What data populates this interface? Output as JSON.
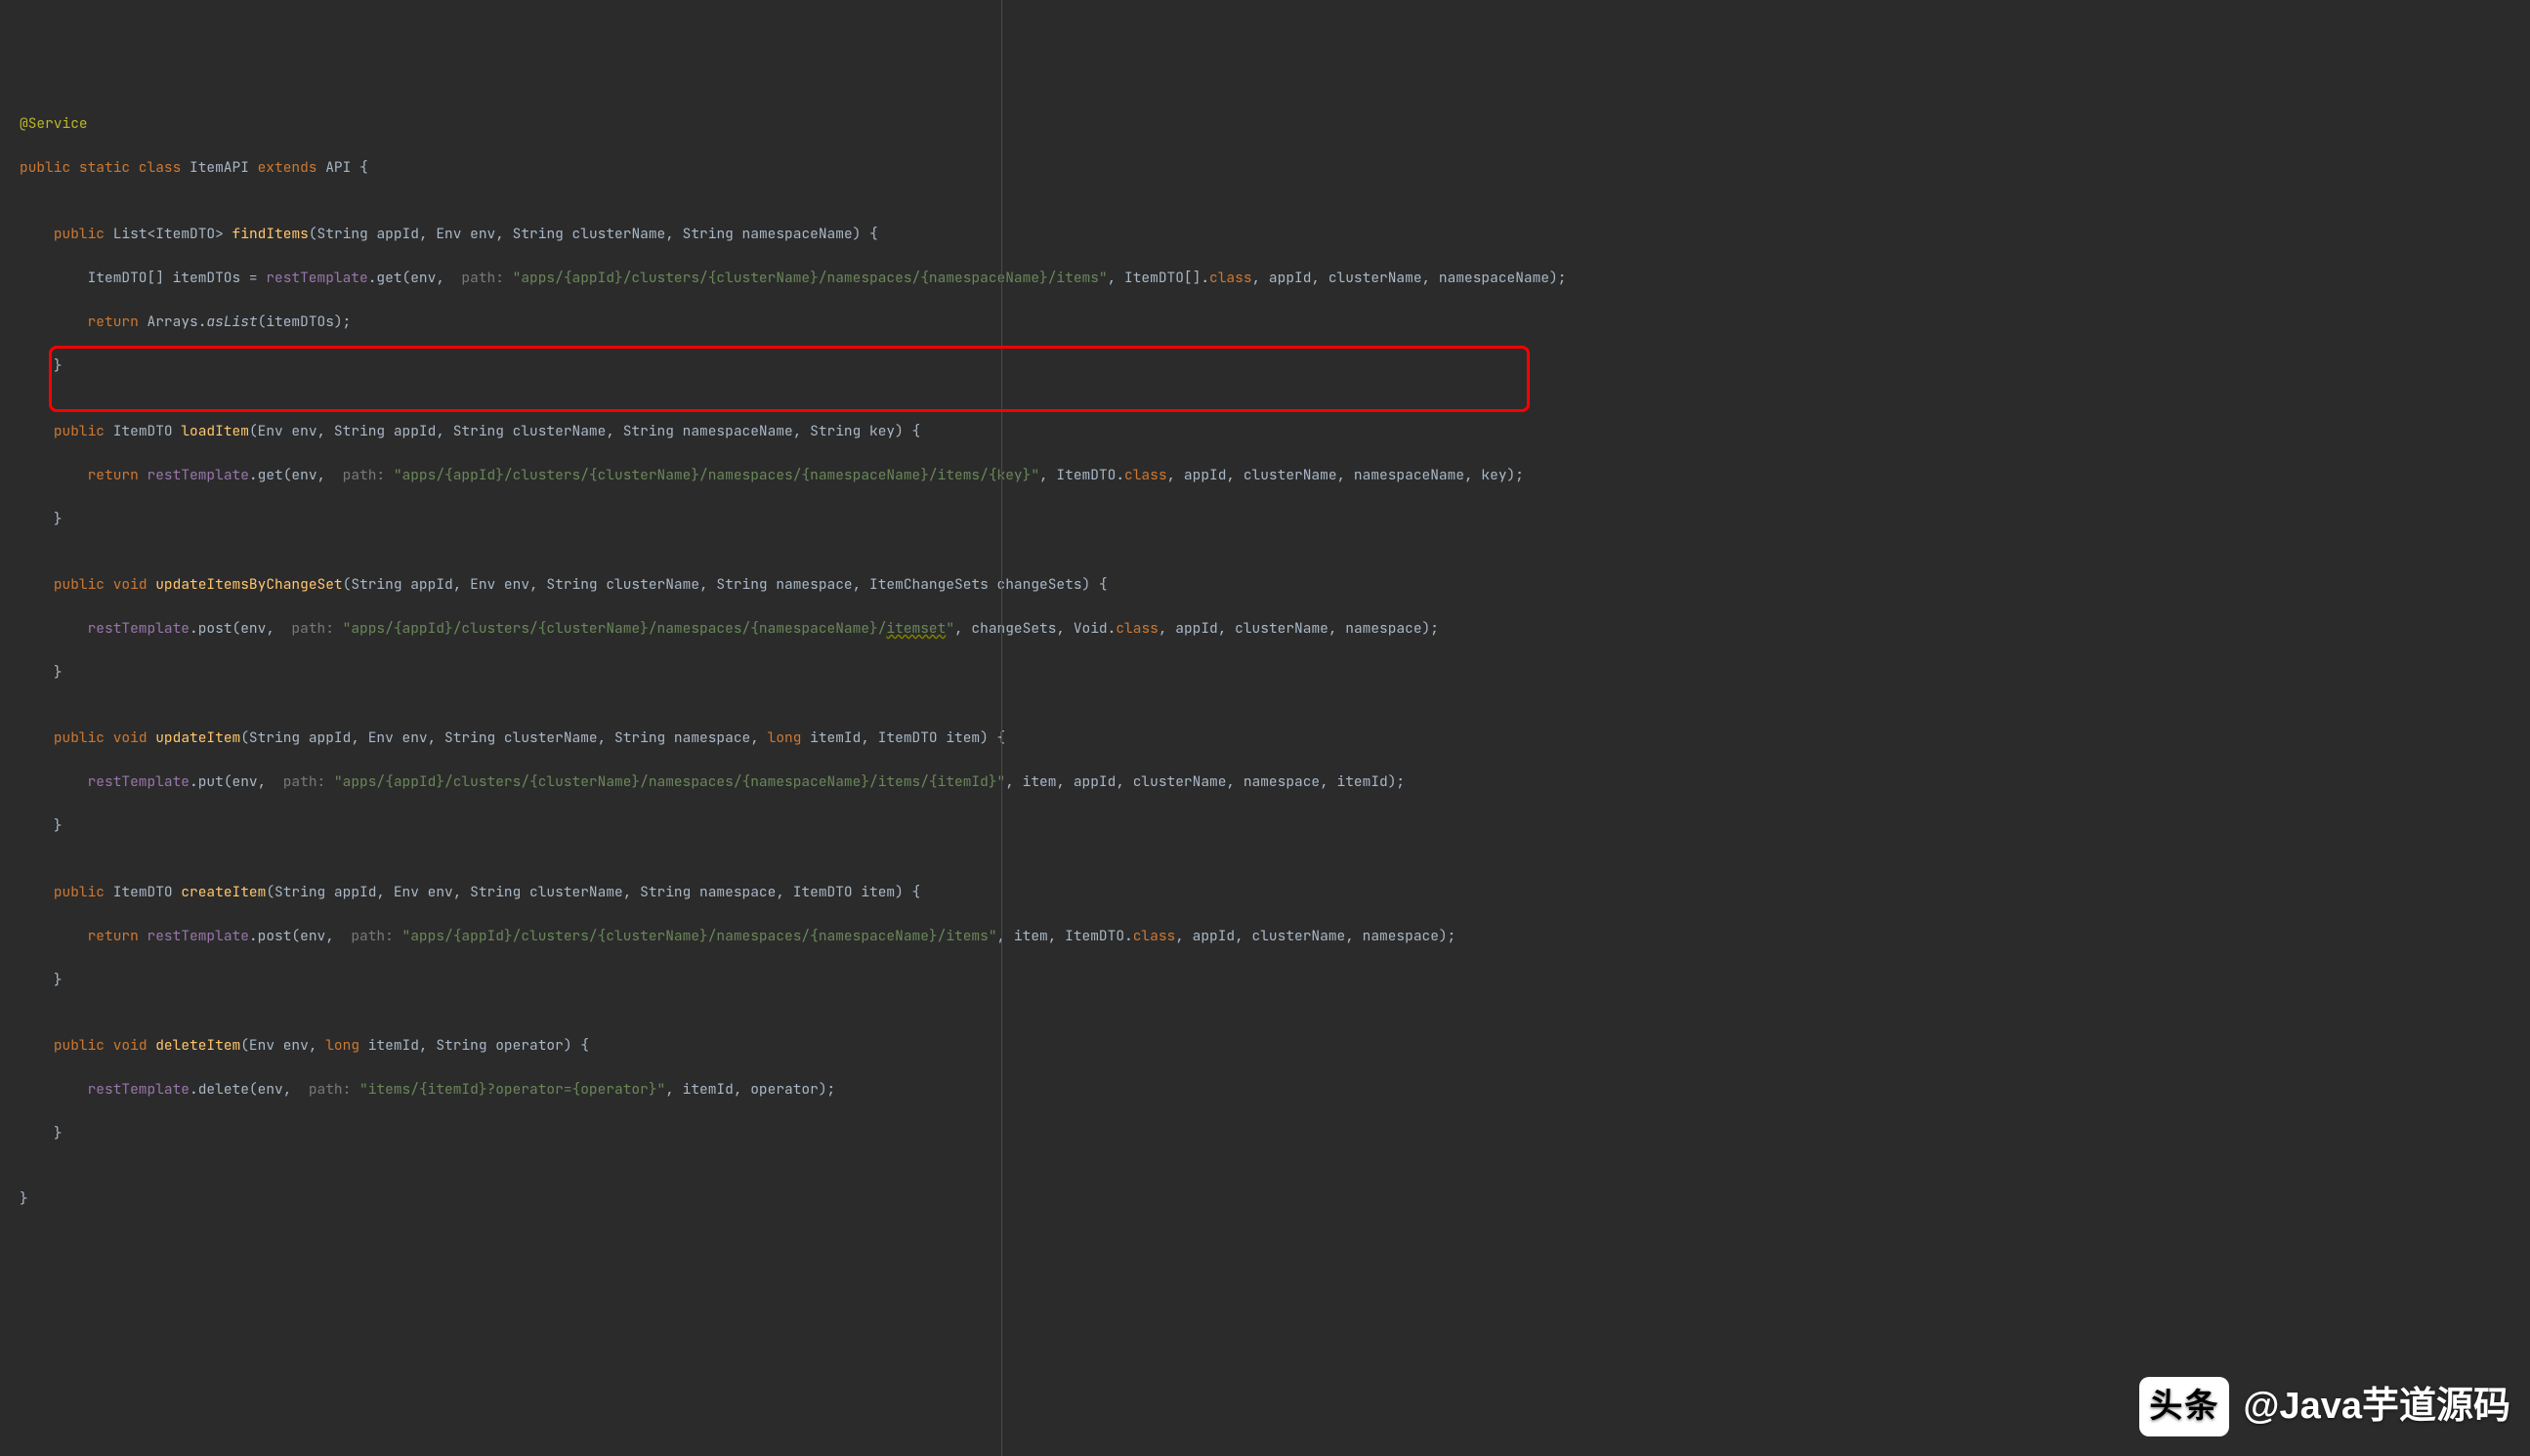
{
  "code": {
    "annotation": "@Service",
    "classDecl": {
      "mods": "public static class ",
      "name": "ItemAPI",
      "extends": " extends ",
      "superName": "API"
    },
    "methods": {
      "findItems": {
        "mods": "public ",
        "returnType": "List",
        "generic": "<ItemDTO>",
        "name": "findItems",
        "params": "(String appId, Env env, String clusterName, String namespaceName) {",
        "bodyLine1a": "ItemDTO[] itemDTOs = ",
        "bodyLine1b": "restTemplate",
        "bodyLine1c": ".get(env, ",
        "hint": "path:",
        "path": "\"apps/{appId}/clusters/{clusterName}/namespaces/{namespaceName}/items\"",
        "bodyLine1d": ", ItemDTO[].",
        "classKw": "class",
        "bodyLine1e": ", appId, clusterName, namespaceName);",
        "returnKw": "return ",
        "arraysCall": "Arrays.",
        "asList": "asList",
        "asListArgs": "(itemDTOs);"
      },
      "loadItem": {
        "mods": "public ",
        "returnType": "ItemDTO ",
        "name": "loadItem",
        "params": "(Env env, String appId, String clusterName, String namespaceName, String key) {",
        "returnKw": "return ",
        "bodyA": "restTemplate",
        "bodyB": ".get(env, ",
        "hint": "path:",
        "path": "\"apps/{appId}/clusters/{clusterName}/namespaces/{namespaceName}/items/{key}\"",
        "bodyC": ", ItemDTO.",
        "classKw": "class",
        "bodyD": ", appId, clusterName, namespaceName, key);"
      },
      "updateItemsByChangeSet": {
        "mods": "public ",
        "voidKw": "void ",
        "name": "updateItemsByChangeSet",
        "params": "(String appId, Env env, String clusterName, String namespace, ItemChangeSets changeSets) {",
        "bodyA": "restTemplate",
        "bodyB": ".post(env, ",
        "hint": "path:",
        "path": "\"apps/{appId}/clusters/{clusterName}/namespaces/{namespaceName}/",
        "itemset": "itemset",
        "pathEnd": "\"",
        "bodyC": ", changeSets, Void.",
        "classKw": "class",
        "bodyD": ", appId, clusterName, namespace);"
      },
      "updateItem": {
        "mods": "public ",
        "voidKw": "void ",
        "name": "updateItem",
        "params": "(String appId, Env env, String clusterName, String namespace, ",
        "longKw": "long",
        "params2": " itemId, ItemDTO item) {",
        "bodyA": "restTemplate",
        "bodyB": ".put(env, ",
        "hint": "path:",
        "path": "\"apps/{appId}/clusters/{clusterName}/namespaces/{namespaceName}/items/{itemId}\"",
        "bodyC": ", item, appId, clusterName, namespace, itemId);"
      },
      "createItem": {
        "mods": "public ",
        "returnType": "ItemDTO ",
        "name": "createItem",
        "params": "(String appId, Env env, String clusterName, String namespace, ItemDTO item) {",
        "returnKw": "return ",
        "bodyA": "restTemplate",
        "bodyB": ".post(env, ",
        "hint": "path:",
        "path": "\"apps/{appId}/clusters/{clusterName}/namespaces/{namespaceName}/items\"",
        "bodyC": ", item, ItemDTO.",
        "classKw": "class",
        "bodyD": ", appId, clusterName, namespace);"
      },
      "deleteItem": {
        "mods": "public ",
        "voidKw": "void ",
        "name": "deleteItem",
        "params": "(Env env, ",
        "longKw": "long",
        "params2": " itemId, String operator) {",
        "bodyA": "restTemplate",
        "bodyB": ".delete(env, ",
        "hint": "path:",
        "path": "\"items/{itemId}?operator={operator}\"",
        "bodyC": ", itemId, operator);"
      }
    },
    "closeBrace": "}"
  },
  "watermark": {
    "logo": "头条",
    "text": "@Java芋道源码"
  }
}
